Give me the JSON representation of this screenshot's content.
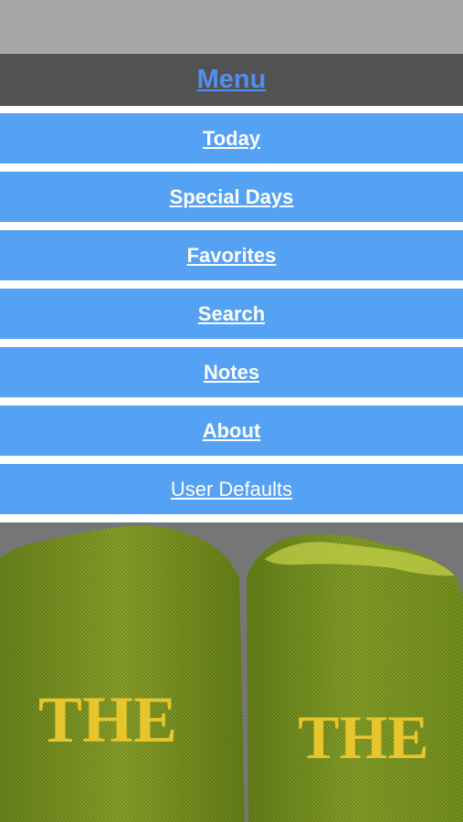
{
  "header": {
    "title": "Menu"
  },
  "menu": {
    "items": [
      {
        "label": "Today"
      },
      {
        "label": "Special Days"
      },
      {
        "label": "Favorites"
      },
      {
        "label": "Search"
      },
      {
        "label": "Notes"
      },
      {
        "label": "About"
      },
      {
        "label": "User Defaults"
      }
    ]
  },
  "image": {
    "book_left_title": "THE",
    "book_right_title": "THE"
  },
  "colors": {
    "status_bar": "#a7a7a7",
    "header_bg": "#525252",
    "title_link": "#4f8ff0",
    "item_bg": "#55a1f4",
    "item_text": "#ffffff"
  }
}
